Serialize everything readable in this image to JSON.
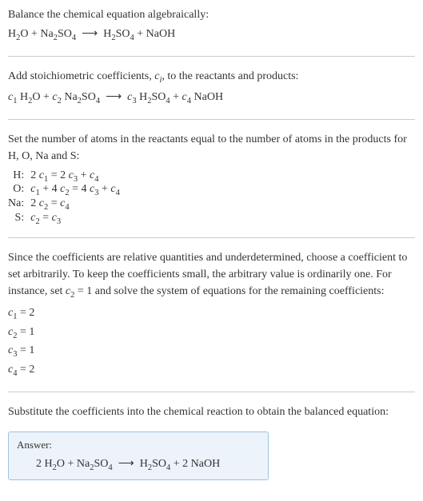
{
  "step1": {
    "text": "Balance the chemical equation algebraically:",
    "equation": "H₂O + Na₂SO₄ ⟶ H₂SO₄ + NaOH"
  },
  "step2": {
    "text_a": "Add stoichiometric coefficients, ",
    "text_b": ", to the reactants and products:",
    "ci": "cᵢ",
    "equation": "c₁ H₂O + c₂ Na₂SO₄ ⟶ c₃ H₂SO₄ + c₄ NaOH"
  },
  "step3": {
    "text": "Set the number of atoms in the reactants equal to the number of atoms in the products for H, O, Na and S:",
    "rows": [
      {
        "label": "H:",
        "eq": "2 c₁ = 2 c₃ + c₄"
      },
      {
        "label": "O:",
        "eq": "c₁ + 4 c₂ = 4 c₃ + c₄"
      },
      {
        "label": "Na:",
        "eq": "2 c₂ = c₄"
      },
      {
        "label": "S:",
        "eq": "c₂ = c₃"
      }
    ]
  },
  "step4": {
    "text_a": "Since the coefficients are relative quantities and underdetermined, choose a coefficient to set arbitrarily. To keep the coefficients small, the arbitrary value is ordinarily one. For instance, set ",
    "set": "c₂ = 1",
    "text_b": " and solve the system of equations for the remaining coefficients:",
    "coeffs": [
      "c₁ = 2",
      "c₂ = 1",
      "c₃ = 1",
      "c₄ = 2"
    ]
  },
  "step5": {
    "text": "Substitute the coefficients into the chemical reaction to obtain the balanced equation:"
  },
  "answer": {
    "label": "Answer:",
    "equation": "2 H₂O + Na₂SO₄ ⟶ H₂SO₄ + 2 NaOH"
  }
}
